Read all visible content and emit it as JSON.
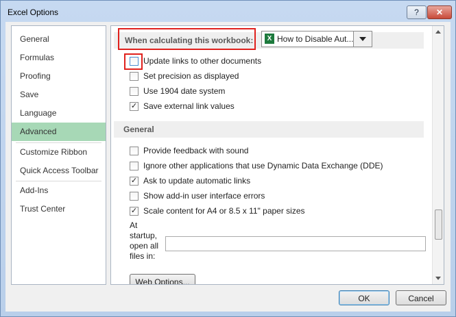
{
  "window": {
    "title": "Excel Options",
    "help_label": "?",
    "close_label": "✕"
  },
  "sidebar": {
    "items": [
      {
        "label": "General"
      },
      {
        "label": "Formulas"
      },
      {
        "label": "Proofing"
      },
      {
        "label": "Save"
      },
      {
        "label": "Language"
      },
      {
        "label": "Advanced",
        "selected": true
      },
      {
        "label": "Customize Ribbon"
      },
      {
        "label": "Quick Access Toolbar"
      },
      {
        "label": "Add-Ins"
      },
      {
        "label": "Trust Center"
      }
    ]
  },
  "calc_section": {
    "label": "When calculating this workbook:",
    "workbook_dropdown": {
      "value": "How to Disable Aut...",
      "icon": "excel-file-icon"
    },
    "options": [
      {
        "label": "Update links to other documents",
        "checked": false
      },
      {
        "label": "Set precision as displayed",
        "checked": false
      },
      {
        "label": "Use 1904 date system",
        "checked": false
      },
      {
        "label": "Save external link values",
        "checked": true
      }
    ]
  },
  "general_section": {
    "label": "General",
    "options": [
      {
        "label": "Provide feedback with sound",
        "checked": false
      },
      {
        "label": "Ignore other applications that use Dynamic Data Exchange (DDE)",
        "checked": false
      },
      {
        "label": "Ask to update automatic links",
        "checked": true
      },
      {
        "label": "Show add-in user interface errors",
        "checked": false
      },
      {
        "label": "Scale content for A4 or 8.5 x 11\" paper sizes",
        "checked": true
      }
    ],
    "startup_label": "At startup, open all files in:",
    "startup_value": "",
    "web_options_label": "Web Options..."
  },
  "footer": {
    "ok_label": "OK",
    "cancel_label": "Cancel"
  },
  "colors": {
    "selected_nav": "#a7d8b6",
    "highlight_box": "#e0201c",
    "section_bg": "#efefef"
  }
}
